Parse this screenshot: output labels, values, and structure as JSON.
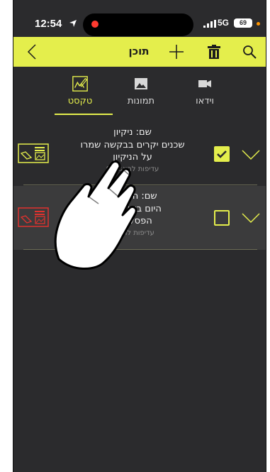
{
  "status_bar": {
    "time": "12:54",
    "network": "5G",
    "battery": "69"
  },
  "header": {
    "title": "תוכן",
    "icons": [
      "back-icon",
      "plus-icon",
      "trash-icon",
      "search-icon"
    ],
    "accent_color": "#e4ee4c"
  },
  "tabs": [
    {
      "label": "וידאו",
      "icon": "video-camera-icon"
    },
    {
      "label": "תמונות",
      "icon": "image-icon"
    },
    {
      "label": "טקסט",
      "icon": "edit-text-icon",
      "selected": true
    }
  ],
  "items": [
    {
      "name": "שם: ניקיון",
      "body_line1": "שכנים יקרים בבקשה שמרו",
      "body_line2": "על הניקיון",
      "preferences": "עדיפות להצגה: 0",
      "checked": true,
      "thumb_color": "#e4ee4c"
    },
    {
      "name": "שם: הפסקת",
      "body_line1": "היום בשעה 00",
      "body_line2": "הפסקת ח",
      "preferences": "עדיפות להצגה",
      "checked": false,
      "thumb_color": "#e0322e"
    }
  ]
}
